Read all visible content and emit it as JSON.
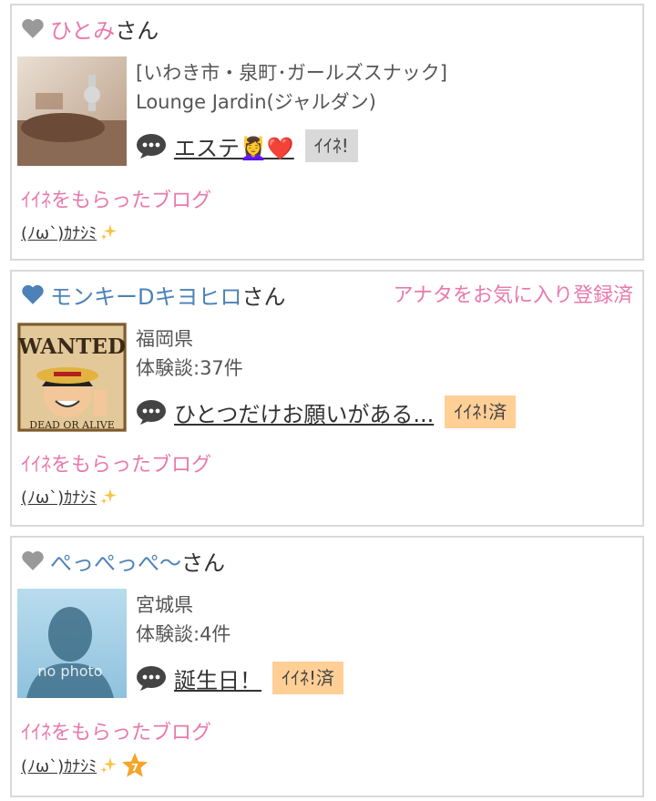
{
  "cards": [
    {
      "name": "ひとみ",
      "suffix": "さん",
      "line1": "[いわき市・泉町･ガールズスナック]",
      "line2": "Lounge Jardin(ジャルダン)",
      "message": "エステ💆‍♀️❤️",
      "iine": "ｲｲﾈ!",
      "blog_title": "ｲｲﾈをもらったブログ",
      "blog_link": "(ﾉω`)ｶﾅｼﾐ"
    },
    {
      "name": "モンキーDキヨヒロ",
      "suffix": "さん",
      "fav": "アナタをお気に入り登録済",
      "line1": "福岡県",
      "line2": "体験談:37件",
      "message": "ひとつだけお願いがある...",
      "iine": "ｲｲﾈ!済",
      "blog_title": "ｲｲﾈをもらったブログ",
      "blog_link": "(ﾉω`)ｶﾅｼﾐ",
      "thumb_text": "WANTED",
      "thumb_sub": "DEAD OR ALIVE"
    },
    {
      "name": "ぺっぺっぺ〜",
      "suffix": "さん",
      "line1": "宮城県",
      "line2": "体験談:4件",
      "message": "誕生日！",
      "iine": "ｲｲﾈ!済",
      "blog_title": "ｲｲﾈをもらったブログ",
      "blog_link": "(ﾉω`)ｶﾅｼﾐ",
      "thumb_text": "no photo",
      "star_number": "7"
    }
  ],
  "colors": {
    "pink": "#e879ad",
    "blue": "#4c82b8",
    "gray_heart": "#999999",
    "iine_done": "#ffcf96",
    "iine_gray": "#d9d9d9"
  }
}
